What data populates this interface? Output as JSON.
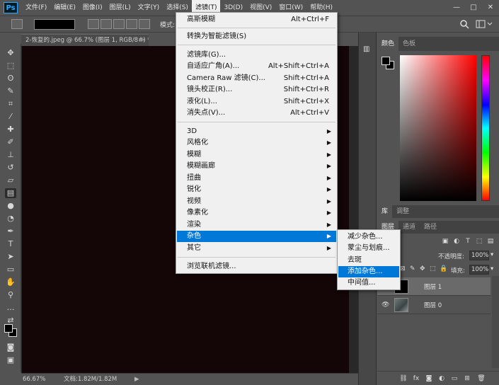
{
  "menubar": {
    "logo": "Ps",
    "items": [
      "文件(F)",
      "编辑(E)",
      "图像(I)",
      "图层(L)",
      "文字(Y)",
      "选择(S)",
      "滤镜(T)",
      "3D(D)",
      "视图(V)",
      "窗口(W)",
      "帮助(H)"
    ],
    "window_controls": [
      "—",
      "□",
      "✕"
    ]
  },
  "options": {
    "mode_label": "模式:"
  },
  "document": {
    "tab_label": "2-恢复的.jpeg @ 66.7% (图层 1, RGB/8#) *",
    "tab_close": "×",
    "canvas_color": "#140507"
  },
  "statusbar": {
    "zoom": "66.67%",
    "doc_info": "文档:1.82M/1.82M",
    "arrow": "▶"
  },
  "color_panel": {
    "tabs": [
      "颜色",
      "色板"
    ],
    "fg": "#000000",
    "bg": "#000000"
  },
  "layers_panel": {
    "top_tabs": [
      "库",
      "调整"
    ],
    "tabs": [
      "图层",
      "通道",
      "路径"
    ],
    "opacity_label": "不透明度:",
    "opacity_value": "100%",
    "fill_label": "填充:",
    "fill_value": "100%",
    "layers": [
      {
        "name": "图层 1",
        "selected": true,
        "visible": false
      },
      {
        "name": "图层 0",
        "selected": false,
        "visible": true
      }
    ]
  },
  "filter_menu": {
    "groups": [
      [
        {
          "label": "高斯模糊",
          "shortcut": "Alt+Ctrl+F"
        }
      ],
      [
        {
          "label": "转换为智能滤镜(S)",
          "shortcut": ""
        }
      ],
      [
        {
          "label": "滤镜库(G)...",
          "shortcut": ""
        },
        {
          "label": "自适应广角(A)...",
          "shortcut": "Alt+Shift+Ctrl+A"
        },
        {
          "label": "Camera Raw 滤镜(C)...",
          "shortcut": "Shift+Ctrl+A"
        },
        {
          "label": "镜头校正(R)...",
          "shortcut": "Shift+Ctrl+R"
        },
        {
          "label": "液化(L)...",
          "shortcut": "Shift+Ctrl+X"
        },
        {
          "label": "消失点(V)...",
          "shortcut": "Alt+Ctrl+V"
        }
      ],
      [
        {
          "label": "3D",
          "submenu": true
        },
        {
          "label": "风格化",
          "submenu": true
        },
        {
          "label": "模糊",
          "submenu": true
        },
        {
          "label": "模糊画廊",
          "submenu": true
        },
        {
          "label": "扭曲",
          "submenu": true
        },
        {
          "label": "锐化",
          "submenu": true
        },
        {
          "label": "视频",
          "submenu": true
        },
        {
          "label": "像素化",
          "submenu": true
        },
        {
          "label": "渲染",
          "submenu": true
        },
        {
          "label": "杂色",
          "submenu": true,
          "highlighted": true
        },
        {
          "label": "其它",
          "submenu": true
        }
      ],
      [
        {
          "label": "浏览联机滤镜...",
          "shortcut": ""
        }
      ]
    ]
  },
  "noise_submenu": {
    "items": [
      "减少杂色...",
      "蒙尘与划痕...",
      "去斑",
      "添加杂色...",
      "中间值..."
    ],
    "highlighted_index": 3
  },
  "colors": {
    "highlight": "#0078d7",
    "menu_bg": "#f0f0f0",
    "ui_bg": "#535353"
  }
}
